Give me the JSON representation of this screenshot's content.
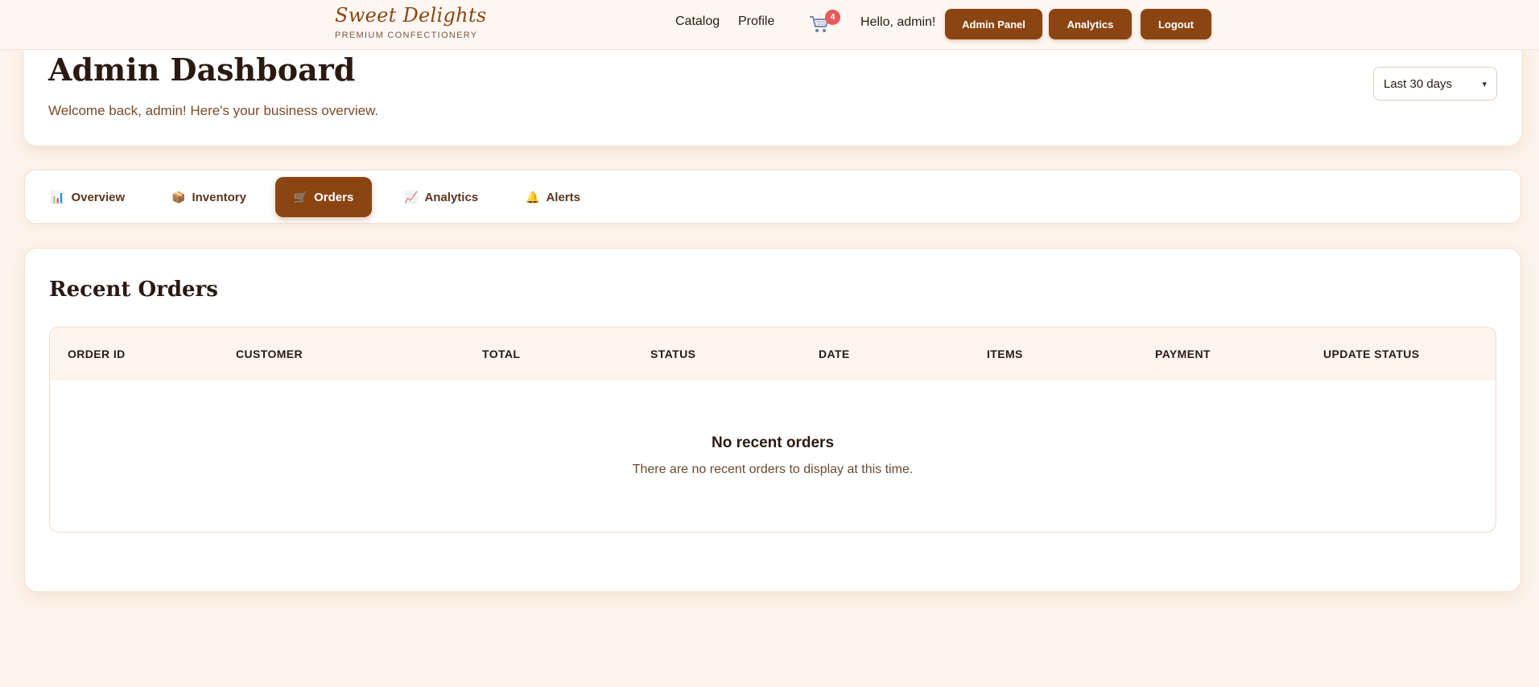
{
  "brand": {
    "name": "Sweet Delights",
    "tagline": "PREMIUM CONFECTIONERY"
  },
  "nav": {
    "links": [
      "Catalog",
      "Profile"
    ],
    "cart_icon": "shopping-cart-icon",
    "cart_count": "4",
    "greeting": "Hello, admin!",
    "buttons": [
      "Admin Panel",
      "Analytics",
      "Logout"
    ]
  },
  "header": {
    "title": "Admin Dashboard",
    "subtitle": "Welcome back, admin! Here's your business overview.",
    "range_selected": "Last 30 days"
  },
  "tabs": [
    {
      "label": "Overview",
      "icon": "bar-chart-icon",
      "glyph": "📊",
      "active": false
    },
    {
      "label": "Inventory",
      "icon": "package-icon",
      "glyph": "📦",
      "active": false
    },
    {
      "label": "Orders",
      "icon": "cart-icon",
      "glyph": "🛒",
      "active": true
    },
    {
      "label": "Analytics",
      "icon": "trend-chart-icon",
      "glyph": "📈",
      "active": false
    },
    {
      "label": "Alerts",
      "icon": "bell-icon",
      "glyph": "🔔",
      "active": false
    }
  ],
  "orders": {
    "title": "Recent Orders",
    "columns": [
      "ORDER ID",
      "CUSTOMER",
      "TOTAL",
      "STATUS",
      "DATE",
      "ITEMS",
      "PAYMENT",
      "UPDATE STATUS"
    ],
    "empty_title": "No recent orders",
    "empty_text": "There are no recent orders to display at this time."
  },
  "colors": {
    "accent": "#8b4513",
    "page_background": "#fdf3ea",
    "badge": "#e85a5a"
  }
}
